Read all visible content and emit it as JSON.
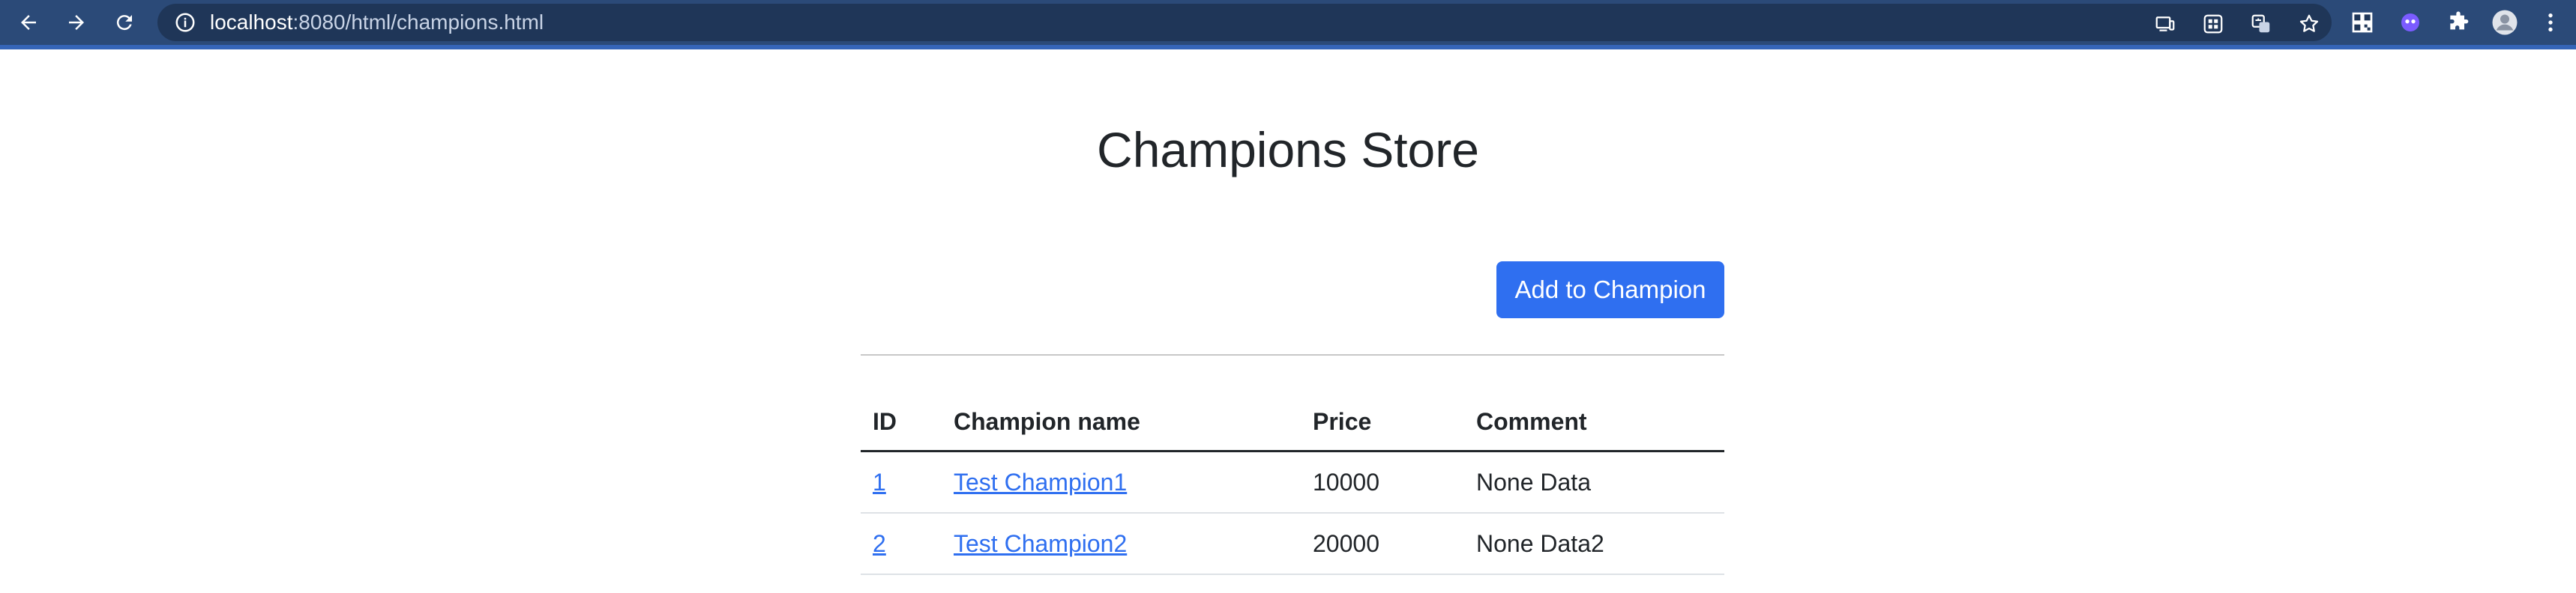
{
  "browser": {
    "url_host": "localhost",
    "url_path": ":8080/html/champions.html"
  },
  "page": {
    "title": "Champions Store",
    "add_button_label": "Add to Champion"
  },
  "table": {
    "headers": [
      "ID",
      "Champion name",
      "Price",
      "Comment"
    ],
    "rows": [
      {
        "id": "1",
        "name": "Test Champion1",
        "price": "10000",
        "comment": "None Data"
      },
      {
        "id": "2",
        "name": "Test Champion2",
        "price": "20000",
        "comment": "None Data2"
      }
    ]
  },
  "colors": {
    "chrome_bg": "#2b4a78",
    "primary": "#2f6ff0",
    "text": "#212529"
  }
}
